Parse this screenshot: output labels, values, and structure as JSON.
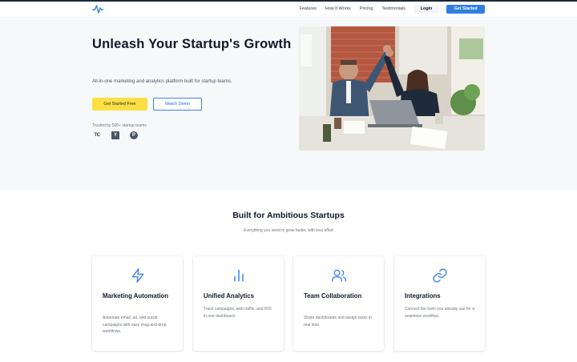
{
  "header": {
    "logo_icon": "pulse-icon",
    "nav": [
      "Features",
      "How It Works",
      "Pricing",
      "Testimonials"
    ],
    "login_label": "Login",
    "cta_label": "Get Started",
    "accent": "#2f7fe0"
  },
  "hero": {
    "title": "Unleash Your Startup's Growth",
    "subtitle": "All-in-one marketing and analytics platform built for startup teams.",
    "primary_cta": "Get Started Free",
    "secondary_cta": "Watch Demo",
    "trusted_text": "Trusted by 500+ startup teams",
    "brands": [
      "TC",
      "Y",
      "P"
    ],
    "primary_color": "#fce043",
    "image": "people-high-five-office-photo"
  },
  "features": {
    "title": "Built for Ambitious Startups",
    "subtitle": "Everything you need to grow faster, with less effort",
    "cards": [
      {
        "icon": "lightning-icon",
        "title": "Marketing Automation",
        "desc": "Automate email, ad, and social campaigns with easy drag-and-drop workflows."
      },
      {
        "icon": "bar-chart-icon",
        "title": "Unified Analytics",
        "desc": "Track campaigns, web traffic, and ROI in one dashboard."
      },
      {
        "icon": "users-icon",
        "title": "Team Collaboration",
        "desc": "Share dashboards and assign tasks in real time."
      },
      {
        "icon": "link-icon",
        "title": "Integrations",
        "desc": "Connect the tools you already use for a seamless workflow."
      }
    ]
  }
}
